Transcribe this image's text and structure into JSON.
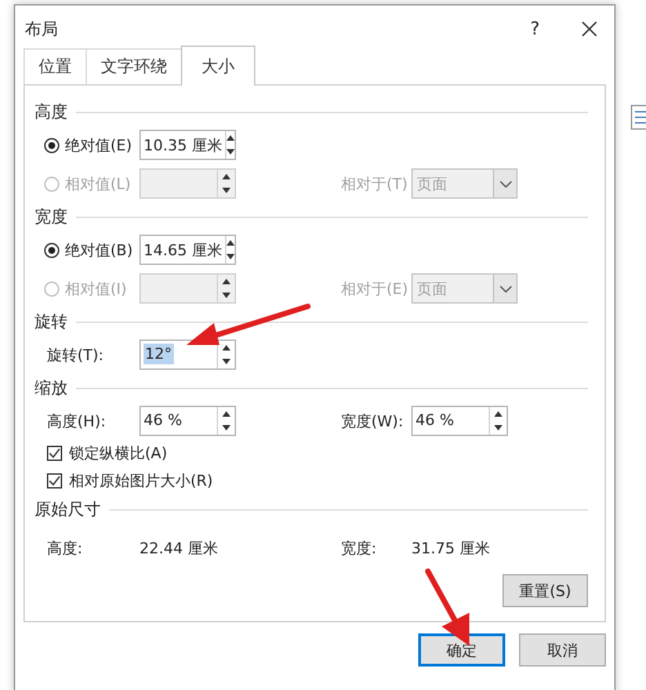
{
  "window": {
    "title": "布局",
    "help": "?"
  },
  "tabs": [
    {
      "label": "位置",
      "selected": false
    },
    {
      "label": "文字环绕",
      "selected": false
    },
    {
      "label": "大小",
      "selected": true
    }
  ],
  "sections": [
    {
      "kind": "dimension",
      "title": "高度",
      "options": [
        {
          "label": "绝对值(E)",
          "selected": true,
          "disabled": false,
          "value": "10.35 厘米"
        },
        {
          "label": "相对值(L)",
          "selected": false,
          "disabled": true
        }
      ],
      "relative_to": {
        "label": "相对于(T)",
        "value": "页面",
        "disabled": true
      }
    },
    {
      "kind": "dimension",
      "title": "宽度",
      "options": [
        {
          "label": "绝对值(B)",
          "selected": true,
          "disabled": false,
          "value": "14.65 厘米"
        },
        {
          "label": "相对值(I)",
          "selected": false,
          "disabled": true
        }
      ],
      "relative_to": {
        "label": "相对于(E)",
        "value": "页面",
        "disabled": true
      }
    },
    {
      "kind": "rotation",
      "title": "旋转",
      "label": "旋转(T):",
      "value": "12°",
      "value_selected": true
    },
    {
      "kind": "scale",
      "title": "缩放",
      "height_label": "高度(H):",
      "height_value": "46 %",
      "width_label": "宽度(W):",
      "width_value": "46 %",
      "checkboxes": [
        {
          "label": "锁定纵横比(A)",
          "checked": true
        },
        {
          "label": "相对原始图片大小(R)",
          "checked": true
        }
      ]
    },
    {
      "kind": "original",
      "title": "原始尺寸",
      "height_label": "高度:",
      "height_value": "22.44 厘米",
      "width_label": "宽度:",
      "width_value": "31.75 厘米",
      "reset": "重置(S)"
    }
  ],
  "buttons": [
    {
      "label": "确定",
      "default": true
    },
    {
      "label": "取消",
      "default": false
    }
  ]
}
